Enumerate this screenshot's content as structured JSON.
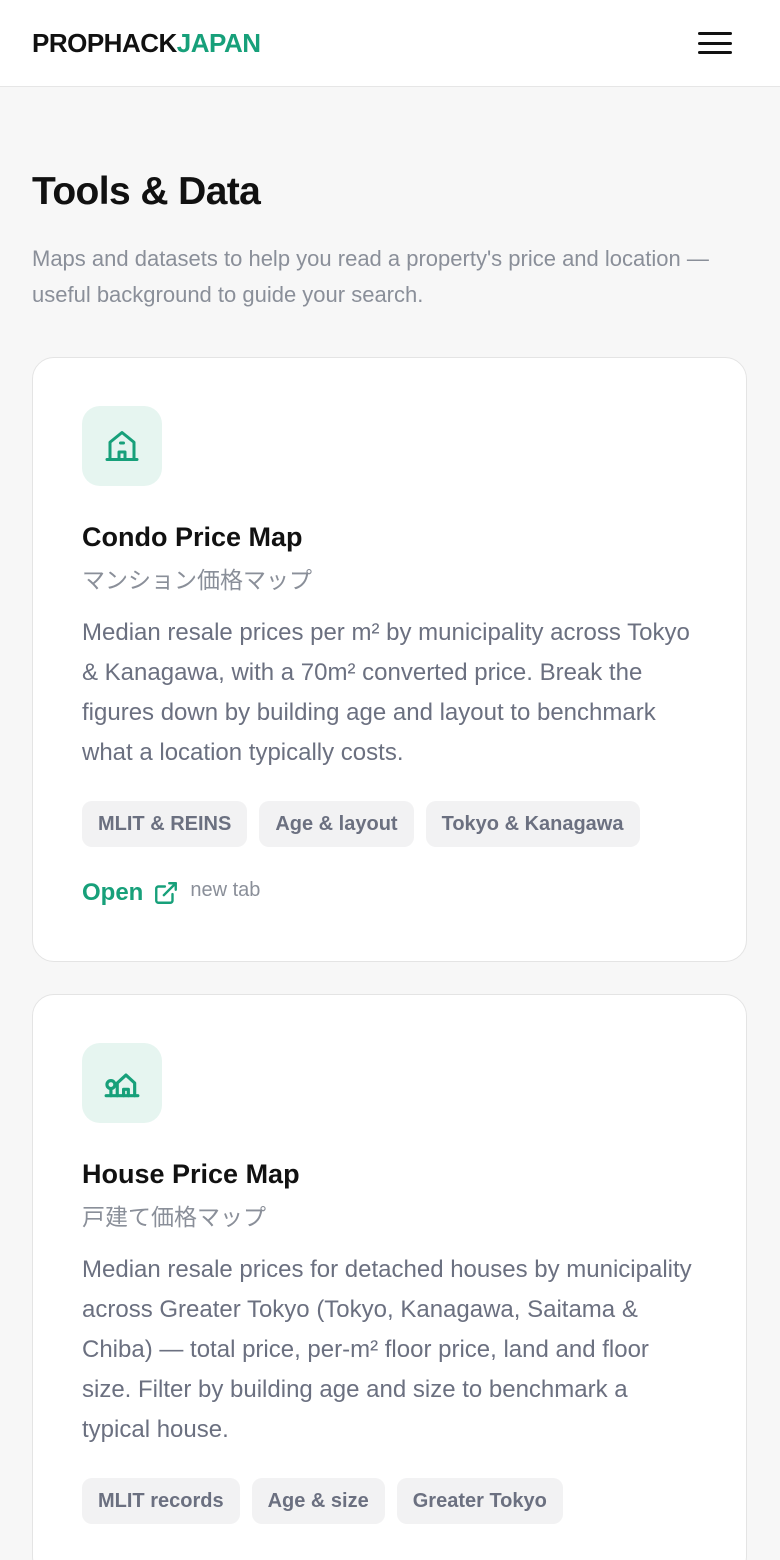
{
  "header": {
    "logo_part1": "PROPHACK",
    "logo_part2": "JAPAN",
    "menu_icon": "hamburger-menu-icon"
  },
  "page": {
    "title": "Tools & Data",
    "subtitle": "Maps and datasets to help you read a property's price and location — useful background to guide your search."
  },
  "cards": [
    {
      "icon": "house-icon",
      "title": "Condo Price Map",
      "jp_title": "マンション価格マップ",
      "description": "Median resale prices per m² by municipality across Tokyo & Kanagawa, with a 70m² converted price. Break the figures down by building age and layout to benchmark what a location typically costs.",
      "tags": [
        "MLIT & REINS",
        "Age & layout",
        "Tokyo & Kanagawa"
      ],
      "open_label": "Open",
      "open_icon": "external-link-icon",
      "new_tab_label": "new tab"
    },
    {
      "icon": "house-tree-icon",
      "title": "House Price Map",
      "jp_title": "戸建て価格マップ",
      "description": "Median resale prices for detached houses by municipality across Greater Tokyo (Tokyo, Kanagawa, Saitama & Chiba) — total price, per-m² floor price, land and floor size. Filter by building age and size to benchmark a typical house.",
      "tags": [
        "MLIT records",
        "Age & size",
        "Greater Tokyo"
      ]
    }
  ],
  "colors": {
    "brand": "#17a07a",
    "icon_bg": "#e6f5f0",
    "muted_text": "#8a8f99",
    "body_text": "#6b7080"
  }
}
